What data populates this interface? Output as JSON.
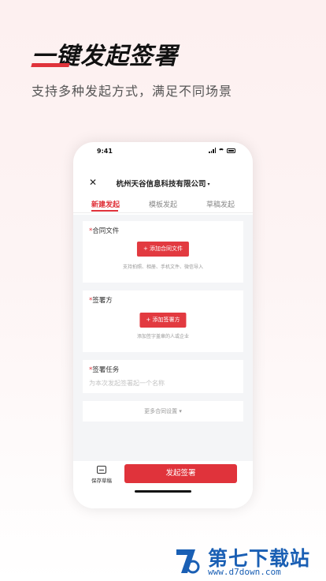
{
  "hero": {
    "title": "一键发起签署",
    "subtitle": "支持多种发起方式，满足不同场景"
  },
  "status_bar": {
    "time": "9:41"
  },
  "nav": {
    "company": "杭州天谷信息科技有限公司",
    "caret": "▾"
  },
  "tabs": [
    {
      "label": "新建发起",
      "active": true
    },
    {
      "label": "模板发起",
      "active": false
    },
    {
      "label": "草稿发起",
      "active": false
    }
  ],
  "sections": {
    "contract_file": {
      "required_mark": "*",
      "label": "合同文件",
      "button": "+ 添加合同文件",
      "hint": "支持拍照、相册、手机文件、微信导入"
    },
    "signer": {
      "required_mark": "*",
      "label": "签署方",
      "button": "+ 添加签署方",
      "hint": "添加签字盖章的人或企业"
    },
    "task": {
      "required_mark": "*",
      "label": "签署任务",
      "placeholder": "为本次发起签署起一个名称"
    },
    "more": {
      "label": "更多合同设置 ▾"
    }
  },
  "bottom": {
    "save_draft": "保存草稿",
    "submit": "发起签署"
  },
  "watermark": {
    "name": "第七下载站",
    "url": "www.d7down.com"
  },
  "colors": {
    "accent": "#e0333b",
    "watermark": "#1a5fb4"
  }
}
